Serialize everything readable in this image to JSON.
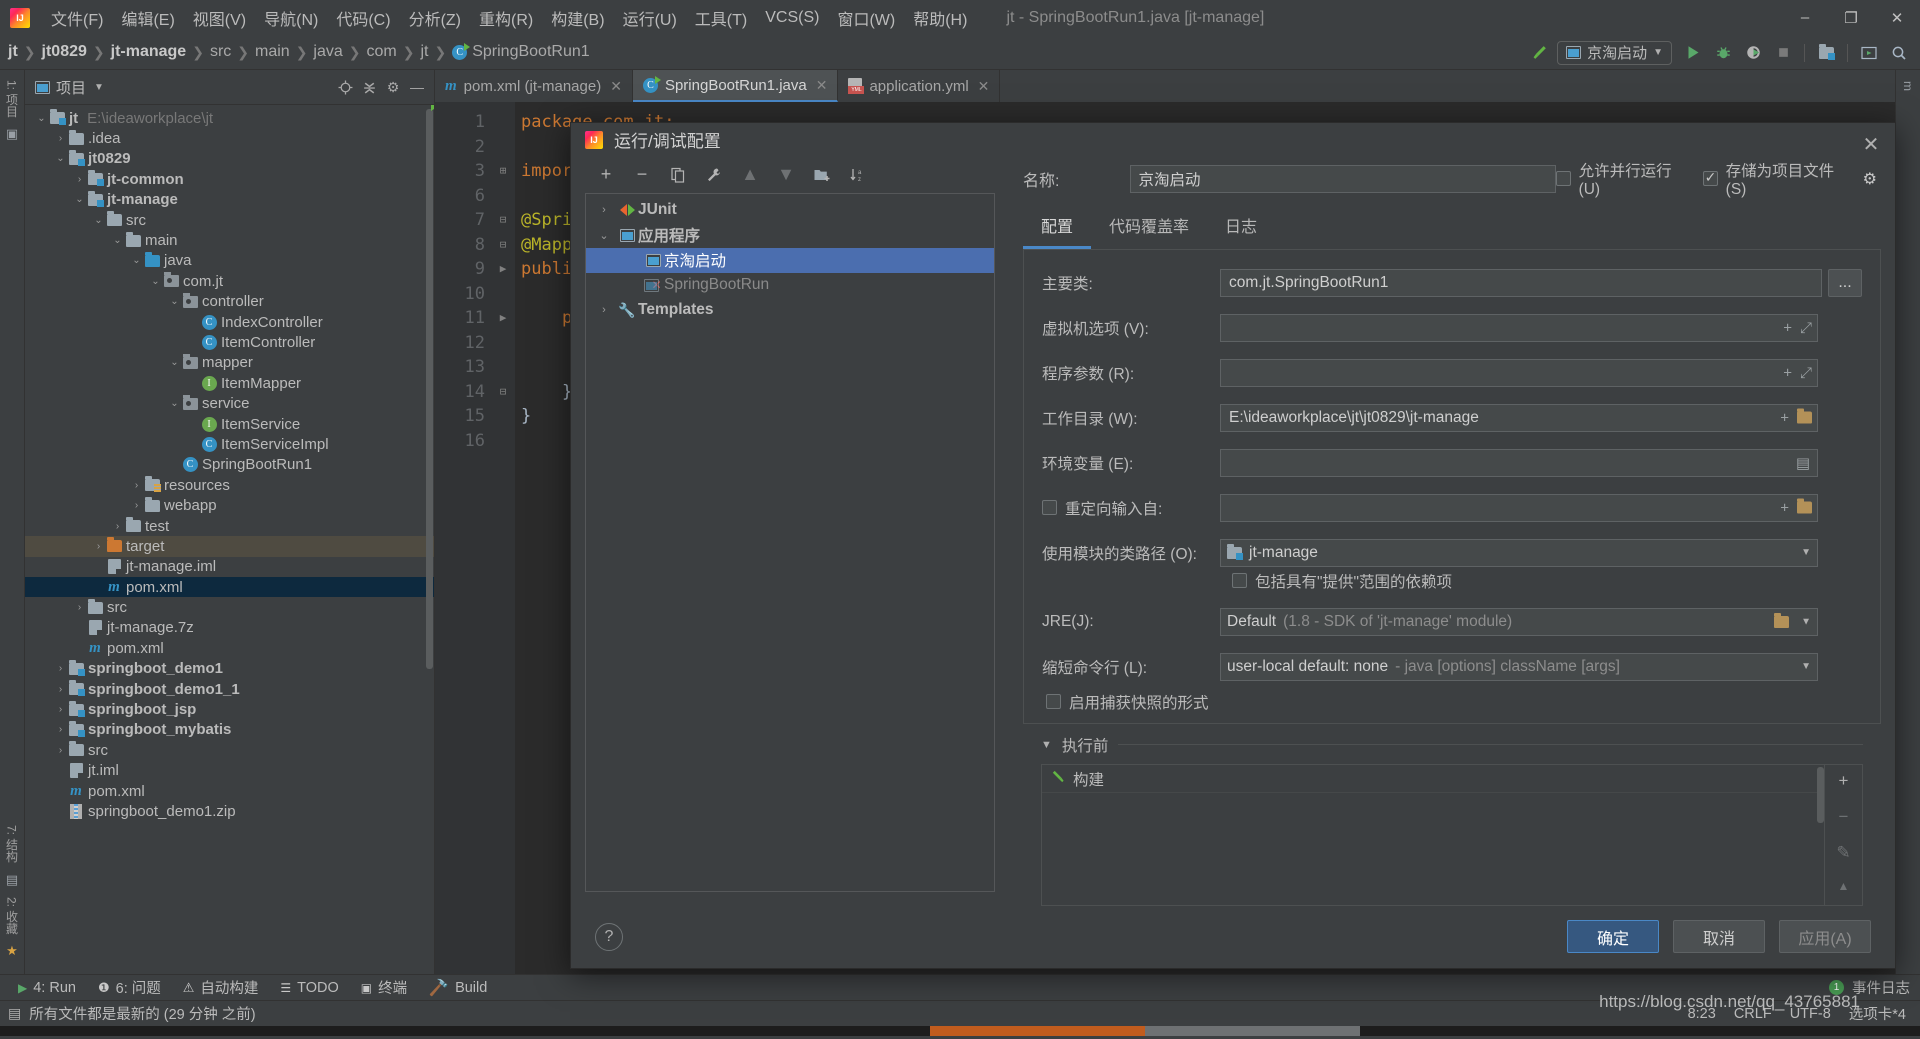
{
  "menubar": {
    "logo": "intellij-logo",
    "items": [
      "文件(F)",
      "编辑(E)",
      "视图(V)",
      "导航(N)",
      "代码(C)",
      "分析(Z)",
      "重构(R)",
      "构建(B)",
      "运行(U)",
      "工具(T)",
      "VCS(S)",
      "窗口(W)",
      "帮助(H)"
    ],
    "window_title": "jt - SpringBootRun1.java [jt-manage]",
    "minimize": "–",
    "maximize": "❐",
    "close": "✕"
  },
  "navbar": {
    "breadcrumbs": [
      "jt",
      "jt0829",
      "jt-manage",
      "src",
      "main",
      "java",
      "com",
      "jt",
      "SpringBootRun1"
    ],
    "run_config": "京淘启动",
    "icons": [
      "build-hammer-icon",
      "run-icon",
      "debug-icon",
      "run-with-coverage-icon",
      "stop-icon",
      "project-structure-icon",
      "preview-icon",
      "search-icon"
    ]
  },
  "project_panel": {
    "title": "项目",
    "header_icons": [
      "locate-icon",
      "collapse-all-icon",
      "settings-gear-icon",
      "hide-icon"
    ],
    "tree": [
      {
        "indent": 0,
        "twist": "v",
        "icon": "folder-module",
        "label": "jt",
        "bold": true,
        "path": "E:\\ideaworkplace\\jt"
      },
      {
        "indent": 1,
        "twist": ">",
        "icon": "folder",
        "label": ".idea",
        "bold": false,
        "path": ""
      },
      {
        "indent": 1,
        "twist": "v",
        "icon": "folder-module",
        "label": "jt0829",
        "bold": true,
        "path": ""
      },
      {
        "indent": 2,
        "twist": ">",
        "icon": "folder-module",
        "label": "jt-common",
        "bold": true,
        "path": ""
      },
      {
        "indent": 2,
        "twist": "v",
        "icon": "folder-module",
        "label": "jt-manage",
        "bold": true,
        "path": ""
      },
      {
        "indent": 3,
        "twist": "v",
        "icon": "folder",
        "label": "src",
        "bold": false,
        "path": ""
      },
      {
        "indent": 4,
        "twist": "v",
        "icon": "folder",
        "label": "main",
        "bold": false,
        "path": ""
      },
      {
        "indent": 5,
        "twist": "v",
        "icon": "folder-src",
        "label": "java",
        "bold": false,
        "path": ""
      },
      {
        "indent": 6,
        "twist": "v",
        "icon": "package",
        "label": "com.jt",
        "bold": false,
        "path": ""
      },
      {
        "indent": 7,
        "twist": "v",
        "icon": "package",
        "label": "controller",
        "bold": false,
        "path": ""
      },
      {
        "indent": 8,
        "twist": "",
        "icon": "class",
        "label": "IndexController",
        "bold": false,
        "path": ""
      },
      {
        "indent": 8,
        "twist": "",
        "icon": "class",
        "label": "ItemController",
        "bold": false,
        "path": ""
      },
      {
        "indent": 7,
        "twist": "v",
        "icon": "package",
        "label": "mapper",
        "bold": false,
        "path": ""
      },
      {
        "indent": 8,
        "twist": "",
        "icon": "interface",
        "label": "ItemMapper",
        "bold": false,
        "path": ""
      },
      {
        "indent": 7,
        "twist": "v",
        "icon": "package",
        "label": "service",
        "bold": false,
        "path": ""
      },
      {
        "indent": 8,
        "twist": "",
        "icon": "interface",
        "label": "ItemService",
        "bold": false,
        "path": ""
      },
      {
        "indent": 8,
        "twist": "",
        "icon": "class",
        "label": "ItemServiceImpl",
        "bold": false,
        "path": ""
      },
      {
        "indent": 7,
        "twist": "",
        "icon": "class-spring",
        "label": "SpringBootRun1",
        "bold": false,
        "path": ""
      },
      {
        "indent": 5,
        "twist": ">",
        "icon": "folder-res",
        "label": "resources",
        "bold": false,
        "path": ""
      },
      {
        "indent": 5,
        "twist": ">",
        "icon": "folder",
        "label": "webapp",
        "bold": false,
        "path": ""
      },
      {
        "indent": 4,
        "twist": ">",
        "icon": "folder",
        "label": "test",
        "bold": false,
        "path": ""
      },
      {
        "indent": 3,
        "twist": ">",
        "icon": "folder-orange",
        "label": "target",
        "bold": false,
        "path": "",
        "state": "highlight"
      },
      {
        "indent": 3,
        "twist": "",
        "icon": "file-iml",
        "label": "jt-manage.iml",
        "bold": false,
        "path": ""
      },
      {
        "indent": 3,
        "twist": "",
        "icon": "file-maven",
        "label": "pom.xml",
        "bold": false,
        "path": "",
        "state": "selected"
      },
      {
        "indent": 2,
        "twist": ">",
        "icon": "folder",
        "label": "src",
        "bold": false,
        "path": ""
      },
      {
        "indent": 2,
        "twist": "",
        "icon": "file-7z",
        "label": "jt-manage.7z",
        "bold": false,
        "path": ""
      },
      {
        "indent": 2,
        "twist": "",
        "icon": "file-maven",
        "label": "pom.xml",
        "bold": false,
        "path": ""
      },
      {
        "indent": 1,
        "twist": ">",
        "icon": "folder-module",
        "label": "springboot_demo1",
        "bold": true,
        "path": ""
      },
      {
        "indent": 1,
        "twist": ">",
        "icon": "folder-module",
        "label": "springboot_demo1_1",
        "bold": true,
        "path": ""
      },
      {
        "indent": 1,
        "twist": ">",
        "icon": "folder-module",
        "label": "springboot_jsp",
        "bold": true,
        "path": ""
      },
      {
        "indent": 1,
        "twist": ">",
        "icon": "folder-module",
        "label": "springboot_mybatis",
        "bold": true,
        "path": ""
      },
      {
        "indent": 1,
        "twist": ">",
        "icon": "folder",
        "label": "src",
        "bold": false,
        "path": ""
      },
      {
        "indent": 1,
        "twist": "",
        "icon": "file-iml",
        "label": "jt.iml",
        "bold": false,
        "path": ""
      },
      {
        "indent": 1,
        "twist": "",
        "icon": "file-maven",
        "label": "pom.xml",
        "bold": false,
        "path": ""
      },
      {
        "indent": 1,
        "twist": "",
        "icon": "file-zip",
        "label": "springboot_demo1.zip",
        "bold": false,
        "path": ""
      }
    ]
  },
  "left_rail": {
    "top_labels": [
      "1: 项目"
    ],
    "bottom_labels": [
      "7: 结构",
      "2: 收藏"
    ]
  },
  "editor": {
    "tabs": [
      {
        "label": "pom.xml (jt-manage)",
        "icon": "maven-icon",
        "active": false
      },
      {
        "label": "SpringBootRun1.java",
        "icon": "spring-class-icon",
        "active": true
      },
      {
        "label": "application.yml",
        "icon": "yml-icon",
        "active": false
      }
    ],
    "line_numbers": [
      "1",
      "2",
      "3",
      "6",
      "7",
      "8",
      "9",
      "10",
      "11",
      "12",
      "13",
      "14",
      "15",
      "16"
    ],
    "code": [
      "package com.jt;",
      "",
      "import",
      "",
      "@Sprin",
      "@Mappe",
      "public",
      "",
      "    pu",
      "",
      "",
      "    }",
      "}",
      ""
    ]
  },
  "dialog": {
    "title": "运行/调试配置",
    "close": "✕",
    "toolbar_buttons": [
      "add-icon",
      "remove-icon",
      "copy-icon",
      "edit-templates-icon",
      "move-up-icon",
      "move-down-icon",
      "new-folder-icon",
      "sort-alphabetically-icon"
    ],
    "tree": [
      {
        "indent": 0,
        "twist": ">",
        "icon": "junit-icon",
        "label": "JUnit",
        "bold": true,
        "state": ""
      },
      {
        "indent": 0,
        "twist": "v",
        "icon": "application-icon",
        "label": "应用程序",
        "bold": true,
        "state": ""
      },
      {
        "indent": 1,
        "twist": "",
        "icon": "app-config-icon",
        "label": "京淘启动",
        "bold": false,
        "state": "selected"
      },
      {
        "indent": 1,
        "twist": "",
        "icon": "app-config-error-icon",
        "label": "SpringBootRun",
        "bold": false,
        "state": "disabled"
      },
      {
        "indent": 0,
        "twist": ">",
        "icon": "wrench-icon",
        "label": "Templates",
        "bold": true,
        "state": ""
      }
    ],
    "name_label": "名称:",
    "name_value": "京淘启动",
    "allow_parallel": {
      "label": "允许并行运行(U)",
      "checked": false
    },
    "store_as_project_file": {
      "label": "存储为项目文件(S)",
      "checked": true
    },
    "gear_icon": "gear-dropdown-icon",
    "tabs": [
      {
        "label": "配置",
        "active": true
      },
      {
        "label": "代码覆盖率",
        "active": false
      },
      {
        "label": "日志",
        "active": false
      }
    ],
    "fields": {
      "main_class": {
        "label": "主要类:",
        "value": "com.jt.SpringBootRun1",
        "browse": "..."
      },
      "vm_options": {
        "label": "虚拟机选项 (V):",
        "value": "",
        "icons": [
          "expand-plus-icon",
          "expand-editor-icon"
        ]
      },
      "program_args": {
        "label": "程序参数 (R):",
        "value": "",
        "icons": [
          "expand-plus-icon",
          "expand-editor-icon"
        ]
      },
      "working_dir": {
        "label": "工作目录 (W):",
        "value": "E:\\ideaworkplace\\jt\\jt0829\\jt-manage",
        "icons": [
          "expand-plus-icon",
          "folder-browse-icon"
        ]
      },
      "env_vars": {
        "label": "环境变量 (E):",
        "value": "",
        "icons": [
          "env-list-icon"
        ]
      },
      "redirect_input": {
        "label": "重定向输入自:",
        "checked": false,
        "value": "",
        "icons": [
          "expand-plus-icon",
          "folder-browse-icon"
        ]
      },
      "module_classpath": {
        "label": "使用模块的类路径 (O):",
        "value": "jt-manage",
        "icon": "module-icon"
      },
      "include_provided": {
        "label": "包括具有\"提供\"范围的依赖项",
        "checked": false
      },
      "jre": {
        "label": "JRE(J):",
        "value": "Default",
        "hint": "(1.8 - SDK of 'jt-manage' module)",
        "icons": [
          "folder-browse-icon"
        ]
      },
      "shorten_cmdline": {
        "label": "缩短命令行 (L):",
        "value": "user-local default: none",
        "hint": "- java [options] className [args]"
      },
      "enable_capture": {
        "label": "启用捕获快照的形式",
        "checked": false
      }
    },
    "before_launch": {
      "title": "执行前",
      "collapse": "▼",
      "items": [
        {
          "icon": "build-hammer-icon",
          "label": "构建"
        }
      ],
      "side_buttons": [
        "add-icon",
        "remove-icon",
        "edit-icon",
        "move-up-icon"
      ]
    },
    "help": "?",
    "buttons": {
      "ok": "确定",
      "cancel": "取消",
      "apply": "应用(A)"
    }
  },
  "toolwindow_bar": {
    "items": [
      {
        "icon": "run-icon",
        "label": "4: Run",
        "mnemonic": "4"
      },
      {
        "icon": "problems-icon",
        "label": "6: 问题",
        "mnemonic": "6"
      },
      {
        "icon": "warning-icon",
        "label": "自动构建",
        "mnemonic": ""
      },
      {
        "icon": "todo-icon",
        "label": "TODO",
        "mnemonic": ""
      },
      {
        "icon": "terminal-icon",
        "label": "终端",
        "mnemonic": ""
      },
      {
        "icon": "build-hammer-icon",
        "label": "Build",
        "mnemonic": ""
      }
    ],
    "event_log": {
      "count": "1",
      "label": "事件日志"
    }
  },
  "statusbar": {
    "icon": "file-sync-icon",
    "message": "所有文件都是最新的 (29 分钟 之前)",
    "right": [
      "8:23",
      "CRLF",
      "UTF-8",
      "选项卡*4"
    ],
    "watermark": "https://blog.csdn.net/qq_43765881"
  }
}
